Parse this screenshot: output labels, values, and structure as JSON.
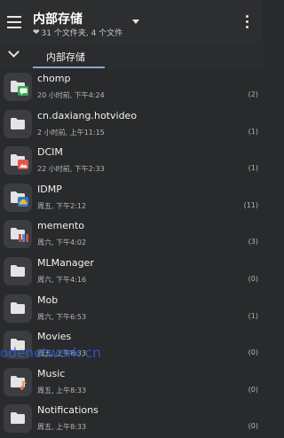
{
  "header": {
    "title": "内部存储",
    "subtitle": "31 个文件夹, 4 个文件",
    "heart_icon": "heart-icon"
  },
  "tabs": [
    {
      "label": "内部存储"
    }
  ],
  "folders": [
    {
      "name": "chomp",
      "meta": "20 小时前, 下午4:24",
      "count": "(2)",
      "badge": "chat-icon",
      "badge_color": "#2ea84e"
    },
    {
      "name": "cn.daxiang.hotvideo",
      "meta": "2 小时前, 上午11:15",
      "count": "(1)",
      "badge": "",
      "badge_color": ""
    },
    {
      "name": "DCIM",
      "meta": "22 小时前, 下午2:33",
      "count": "(1)",
      "badge": "image-icon",
      "badge_color": "#e2574c"
    },
    {
      "name": "IDMP",
      "meta": "周五, 下午2:12",
      "count": "(11)",
      "badge": "cloud-icon",
      "badge_color": "#2e79c9"
    },
    {
      "name": "memento",
      "meta": "周六, 下午4:02",
      "count": "(3)",
      "badge": "bars-icon",
      "badge_color": "#d24848"
    },
    {
      "name": "MLManager",
      "meta": "周六, 下午4:16",
      "count": "(0)",
      "badge": "",
      "badge_color": ""
    },
    {
      "name": "Mob",
      "meta": "周六, 下午6:53",
      "count": "(1)",
      "badge": "",
      "badge_color": ""
    },
    {
      "name": "Movies",
      "meta": "周五, 上午8:33",
      "count": "(0)",
      "badge": "",
      "badge_color": ""
    },
    {
      "name": "Music",
      "meta": "周五, 上午8:33",
      "count": "(0)",
      "badge": "music-icon",
      "badge_color": "#e8734a"
    },
    {
      "name": "Notifications",
      "meta": "周五, 上午8:33",
      "count": "(0)",
      "badge": "",
      "badge_color": ""
    }
  ],
  "watermark": "odenetwork.cn",
  "colors": {
    "background": "#282a2c",
    "folder_tile": "#3b3d40",
    "accent_underline": "#8aa4c8"
  }
}
